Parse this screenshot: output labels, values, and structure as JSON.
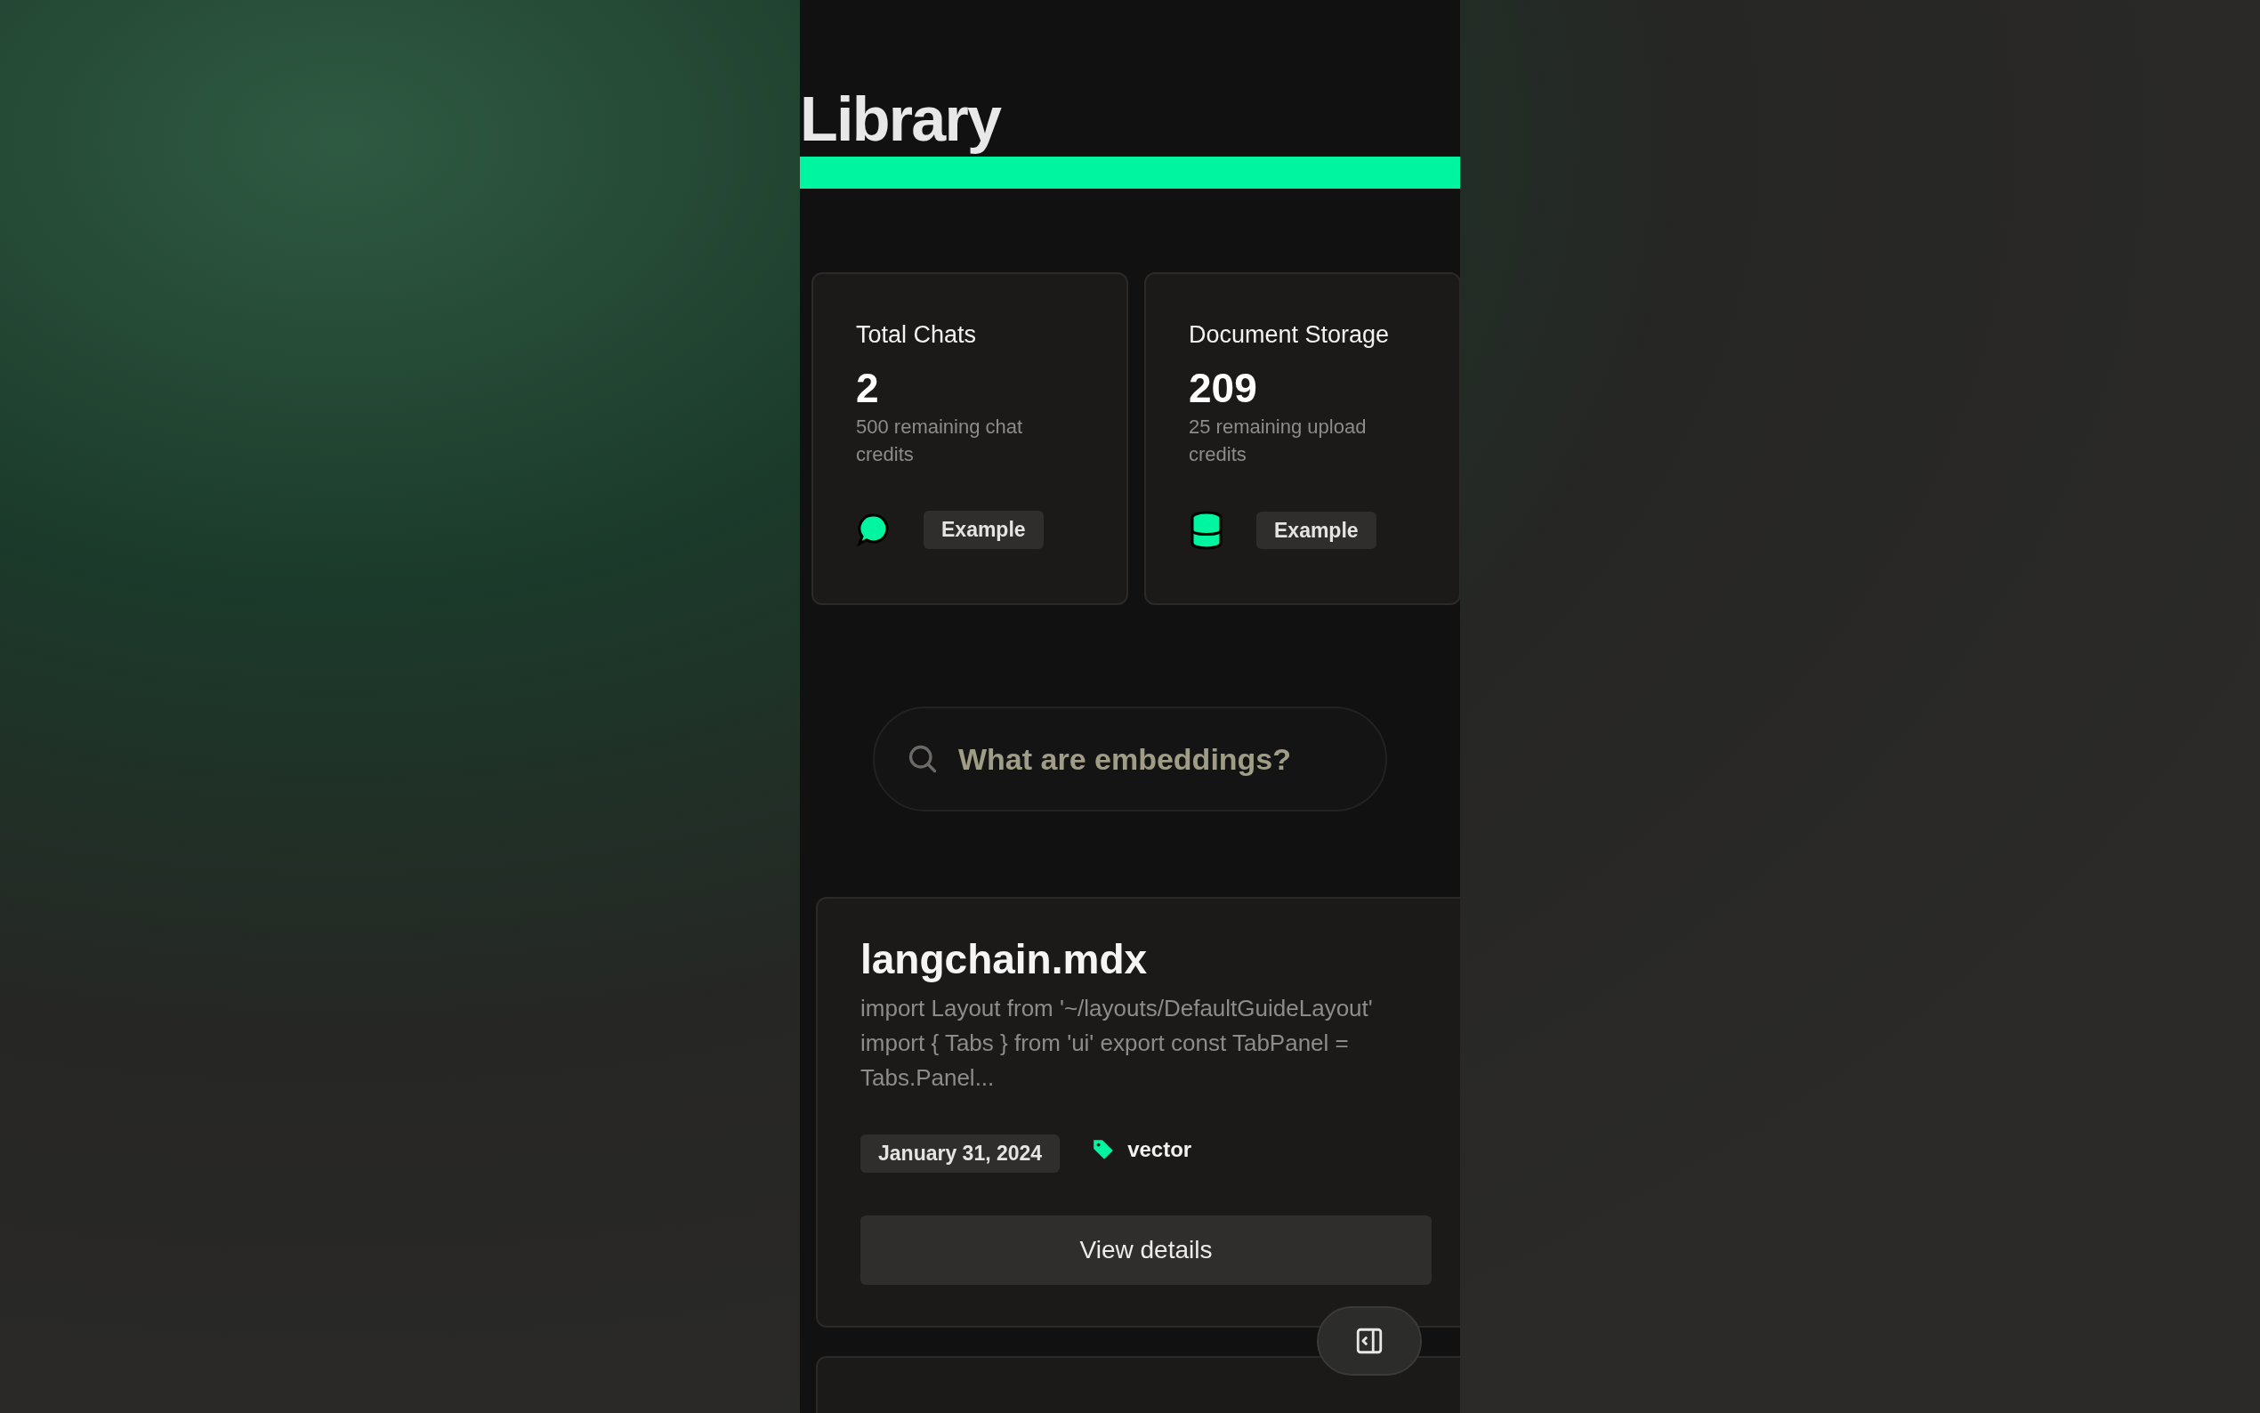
{
  "page": {
    "title": "Library"
  },
  "stats": [
    {
      "title": "Total Chats",
      "value": "2",
      "subtitle": "500 remaining chat credits",
      "kind": "chat",
      "badge": "Example"
    },
    {
      "title": "Document Storage",
      "value": "209",
      "subtitle": "25 remaining upload credits",
      "kind": "storage",
      "badge": "Example"
    }
  ],
  "search": {
    "placeholder": "What are embeddings?"
  },
  "documents": [
    {
      "title": "langchain.mdx",
      "excerpt": "import Layout from '~/layouts/DefaultGuideLayout' import { Tabs } from 'ui' export const TabPanel = Tabs.Panel...",
      "date": "January 31, 2024",
      "tag": "vector",
      "action": "View details"
    }
  ]
}
